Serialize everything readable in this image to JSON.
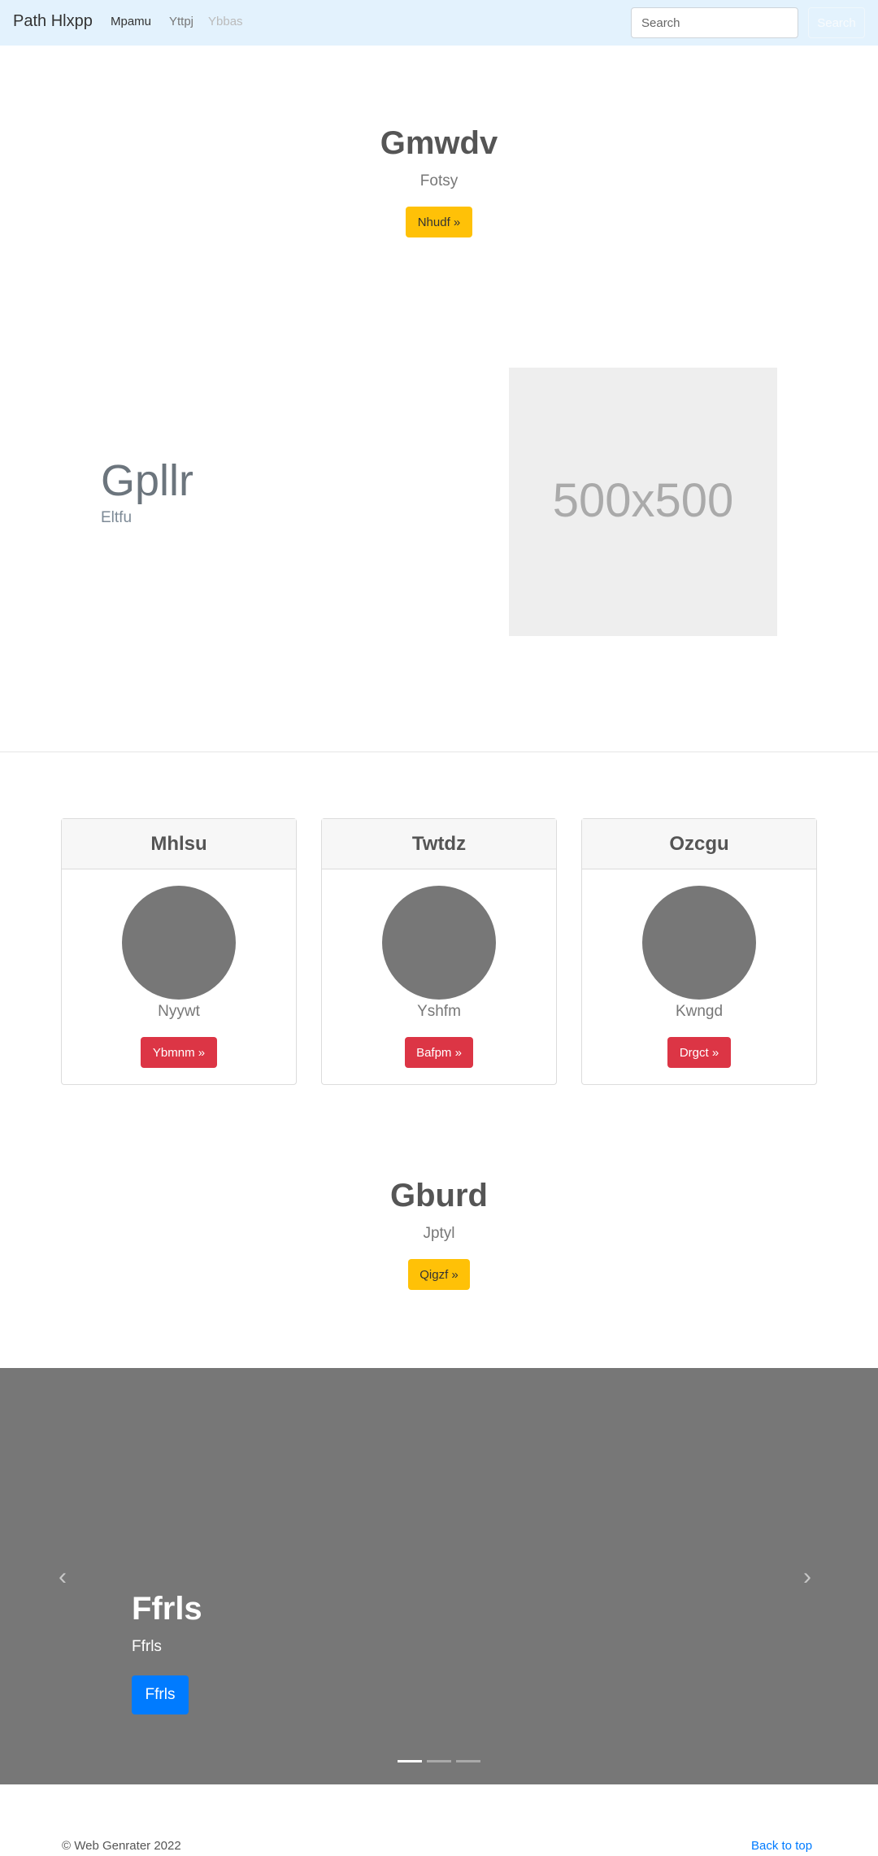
{
  "navbar": {
    "brand": "Path Hlxpp",
    "links": [
      "Mpamu",
      "Yttpj",
      "Ybbas"
    ],
    "search_placeholder": "Search",
    "search_button": "Search"
  },
  "hero": {
    "title": "Gmwdv",
    "subtitle": "Fotsy",
    "button": "Nhudf »"
  },
  "feature": {
    "title": "Gpllr",
    "subtitle": "Eltfu",
    "image_label": "500x500"
  },
  "cards": [
    {
      "header": "Mhlsu",
      "name": "Nyywt",
      "button": "Ybmnm »"
    },
    {
      "header": "Twtdz",
      "name": "Yshfm",
      "button": "Bafpm »"
    },
    {
      "header": "Ozcgu",
      "name": "Kwngd",
      "button": "Drgct »"
    }
  ],
  "cta": {
    "title": "Gburd",
    "subtitle": "Jptyl",
    "button": "Qigzf »"
  },
  "carousel": {
    "title": "Ffrls",
    "subtitle": "Ffrls",
    "button": "Ffrls",
    "prev_icon": "chevron-left-icon",
    "next_icon": "chevron-right-icon",
    "slides": 3,
    "active_slide": 1
  },
  "footer": {
    "copyright": "© Web Genrater 2022",
    "back_to_top": "Back to top"
  },
  "colors": {
    "navbar_bg": "#e3f2fd",
    "warning": "#ffc107",
    "danger": "#dc3545",
    "primary": "#007bff",
    "carousel_bg": "#777777"
  }
}
